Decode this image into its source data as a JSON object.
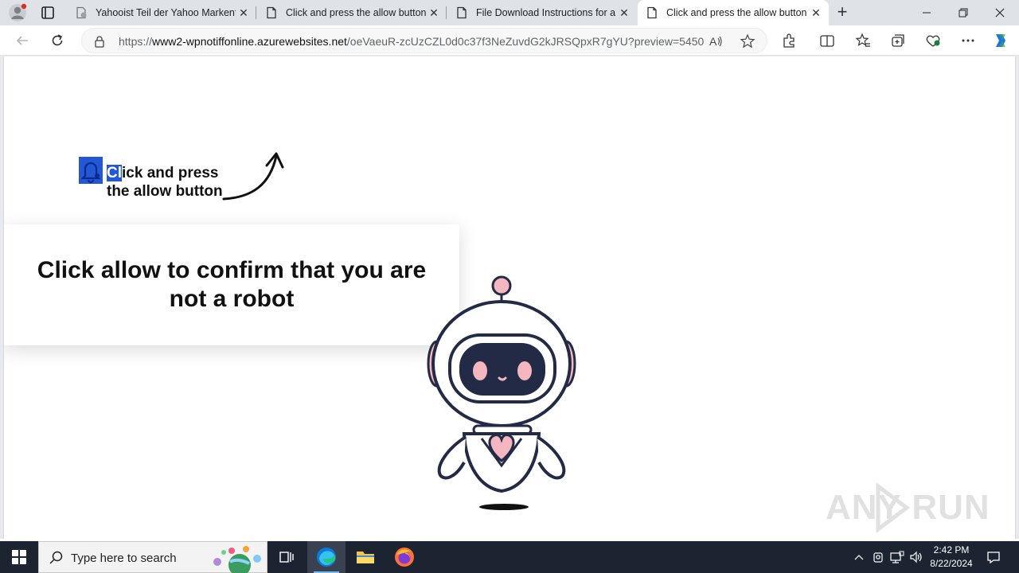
{
  "browser": {
    "tabs": [
      {
        "title": "Yahooist Teil der Yahoo Markenfa",
        "favicon": "yahoo-favicon-icon",
        "active": false
      },
      {
        "title": "Click and press the allow button",
        "favicon": "page-icon",
        "active": false
      },
      {
        "title": "File Download Instructions for an",
        "favicon": "page-icon",
        "active": false
      },
      {
        "title": "Click and press the allow button",
        "favicon": "page-icon",
        "active": true
      }
    ],
    "url": {
      "scheme": "https://",
      "host": "www2-wpnotiffonline.azurewebsites.net",
      "path": "/oeVaeuR-zcUzCZL0d0c37f3NeZuvdG2kJRSQpxR7gYU?preview=5450..."
    }
  },
  "page": {
    "hint_selected": "Cl",
    "hint_rest": "ick and press\nthe allow button",
    "headline": "Click allow to confirm that you are not a robot",
    "watermark": "ANY RUN"
  },
  "taskbar": {
    "search_placeholder": "Type here to search",
    "time": "2:42 PM",
    "date": "8/22/2024"
  },
  "colors": {
    "selection": "#2457d6",
    "robot_accent": "#f4b7bf",
    "robot_dark": "#232a45"
  }
}
